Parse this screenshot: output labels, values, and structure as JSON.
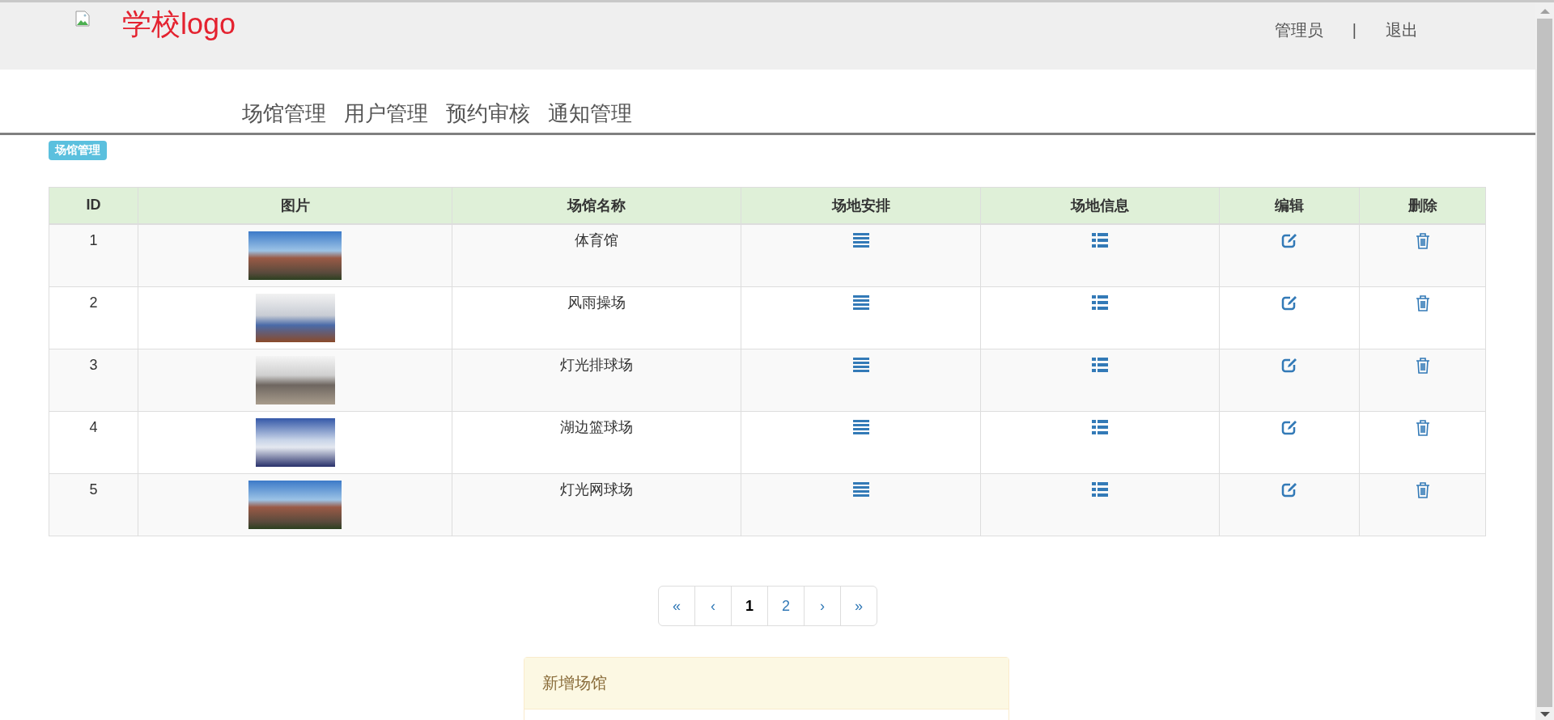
{
  "header": {
    "logo_text": "学校logo",
    "user": "管理员",
    "separator": "|",
    "logout": "退出"
  },
  "nav": [
    {
      "label": "场馆管理"
    },
    {
      "label": "用户管理"
    },
    {
      "label": "预约审核"
    },
    {
      "label": "通知管理"
    }
  ],
  "badge": "场馆管理",
  "table": {
    "columns": [
      "ID",
      "图片",
      "场馆名称",
      "场地安排",
      "场地信息",
      "编辑",
      "删除"
    ],
    "rows": [
      {
        "id": "1",
        "name": "体育馆"
      },
      {
        "id": "2",
        "name": "风雨操场"
      },
      {
        "id": "3",
        "name": "灯光排球场"
      },
      {
        "id": "4",
        "name": "湖边篮球场"
      },
      {
        "id": "5",
        "name": "灯光网球场"
      }
    ]
  },
  "pagination": [
    {
      "label": "«",
      "selected": false
    },
    {
      "label": "‹",
      "selected": false
    },
    {
      "label": "1",
      "selected": true
    },
    {
      "label": "2",
      "selected": false
    },
    {
      "label": "›",
      "selected": false
    },
    {
      "label": "»",
      "selected": false
    }
  ],
  "panel": {
    "title": "新增场馆"
  }
}
